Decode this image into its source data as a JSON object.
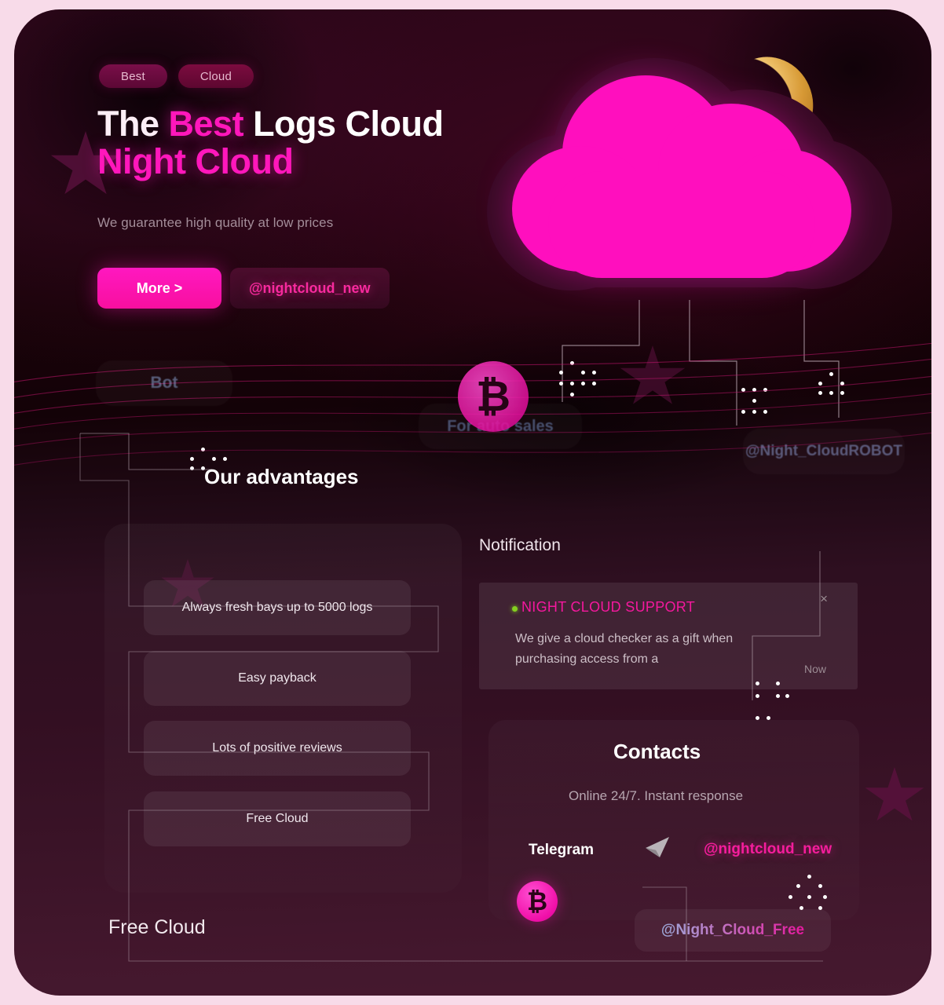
{
  "hero": {
    "badges": [
      {
        "label": "Best"
      },
      {
        "label": "Cloud"
      }
    ],
    "title_part1": "The ",
    "title_highlight": "Best",
    "title_part2": " Logs Cloud",
    "title_line2": "Night Cloud",
    "subtitle": "We guarantee high quality at low prices",
    "more_button": "More >",
    "telegram_button": "@nightcloud_new"
  },
  "decor": {
    "ghost_bot": "Bot",
    "ghost_autosales": "For auto sales",
    "ghost_robot": "@Night_CloudROBOT",
    "bitcoin_symbol": "₿",
    "moon_icon": "crescent-moon",
    "cloud_icon": "cloud"
  },
  "advantages": {
    "title": "Our advantages",
    "items": [
      {
        "label": "Always fresh bays up to 5000 logs"
      },
      {
        "label": "Easy payback"
      },
      {
        "label": "Lots of positive reviews"
      },
      {
        "label": "Free Cloud"
      }
    ]
  },
  "notification": {
    "title": "Notification",
    "sender": "NIGHT CLOUD SUPPORT",
    "body": "We give a cloud checker as a gift when purchasing access from a",
    "time": "Now",
    "close": "×",
    "status_color": "#84d020",
    "sender_color": "#f5189e"
  },
  "contacts": {
    "title": "Contacts",
    "subtitle": "Online 24/7. Instant response",
    "channel_label": "Telegram",
    "handle": "@nightcloud_new",
    "telegram_icon": "paper-plane-icon",
    "bitcoin_symbol": "₿"
  },
  "footer": {
    "label": "Free Cloud",
    "handle": "@Night_Cloud_Free"
  },
  "theme": {
    "accent": "#ff17bb",
    "accent_deep": "#f5189e",
    "page_bg": "#f8dbe9",
    "card_bg": "#2a0617",
    "gold": "#f6cf7e"
  }
}
